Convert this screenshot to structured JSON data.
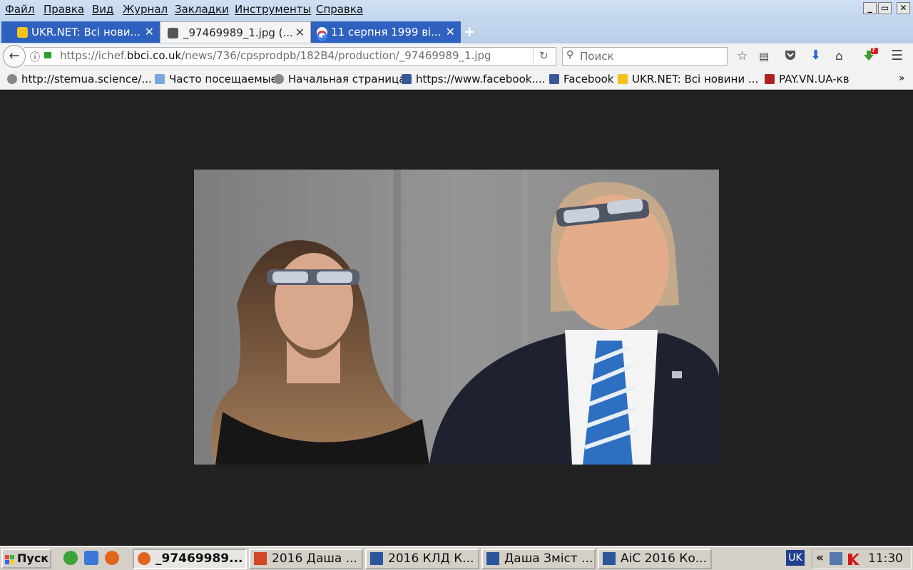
{
  "menubar": {
    "items": [
      "Файл",
      "Правка",
      "Вид",
      "Журнал",
      "Закладки",
      "Инструменты",
      "Справка"
    ],
    "window_buttons": [
      "_",
      "▭",
      "✕"
    ]
  },
  "tabs": [
    {
      "title": "UKR.NET: Всі нови...",
      "active": false
    },
    {
      "title": "_97469989_1.jpg (...",
      "active": true
    },
    {
      "title": "11 серпня 1999 ві...",
      "active": false
    }
  ],
  "close_glyph": "✕",
  "new_tab_glyph": "+",
  "navbar": {
    "back_glyph": "←",
    "url_prefix": "https://ichef.",
    "url_domain": "bbci.co.uk",
    "url_path": "/news/736/cpsprodpb/182B4/production/_97469989_1.jpg",
    "search_placeholder": "Поиск",
    "download_badge": "?"
  },
  "bookmarks": [
    {
      "label": "http://stemua.science/...",
      "icon": "globe-icon"
    },
    {
      "label": "Часто посещаемые",
      "icon": "folder-icon"
    },
    {
      "label": "Начальная страница",
      "icon": "globe-icon"
    },
    {
      "label": "https://www.facebook....",
      "icon": "facebook-icon"
    },
    {
      "label": "Facebook",
      "icon": "facebook-icon"
    },
    {
      "label": "UKR.NET: Всі новини ...",
      "icon": "ukrnet-icon"
    },
    {
      "label": "PAY.VN.UA-кв",
      "icon": "pay-icon"
    }
  ],
  "bookmarks_overflow": "»",
  "taskbar": {
    "start_label": "Пуск",
    "tasks": [
      {
        "label": "_97469989...",
        "icon": "firefox-icon",
        "active": true
      },
      {
        "label": "2016 Даша ...",
        "icon": "powerpoint-icon",
        "active": false
      },
      {
        "label": "2016 КЛД К...",
        "icon": "word-icon",
        "active": false
      },
      {
        "label": "Даша Зміст ...",
        "icon": "word-icon",
        "active": false
      },
      {
        "label": "АіС 2016 Ко...",
        "icon": "word-icon",
        "active": false
      }
    ],
    "language": "UK",
    "tray_expand": "«",
    "clock": "11:30"
  },
  "colors": {
    "content_bg": "#212121",
    "tab_bg": "#2f61c0",
    "menubar_bg": "#c8dbf2",
    "taskbar_bg": "#d4d0c8"
  }
}
